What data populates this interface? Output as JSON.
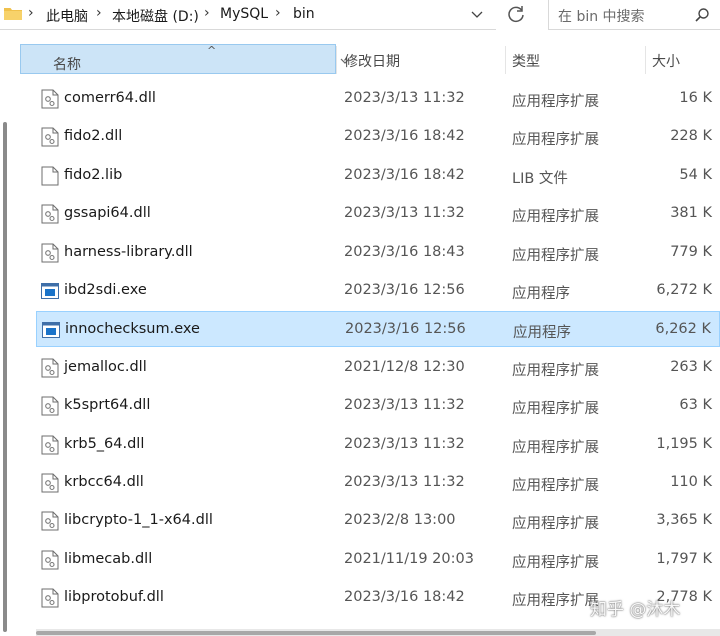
{
  "breadcrumb": {
    "items": [
      "此电脑",
      "本地磁盘 (D:)",
      "MySQL",
      "bin"
    ],
    "separator": "›"
  },
  "search": {
    "placeholder": "在 bin 中搜索"
  },
  "columns": {
    "name": "名称",
    "date": "修改日期",
    "type": "类型",
    "size": "大小"
  },
  "files": [
    {
      "name": "comerr64.dll",
      "date": "2023/3/13 11:32",
      "type": "应用程序扩展",
      "size": "16 K",
      "icon": "dll-file-icon"
    },
    {
      "name": "fido2.dll",
      "date": "2023/3/16 18:42",
      "type": "应用程序扩展",
      "size": "228 K",
      "icon": "dll-file-icon"
    },
    {
      "name": "fido2.lib",
      "date": "2023/3/16 18:42",
      "type": "LIB 文件",
      "size": "54 K",
      "icon": "blank-file-icon"
    },
    {
      "name": "gssapi64.dll",
      "date": "2023/3/13 11:32",
      "type": "应用程序扩展",
      "size": "381 K",
      "icon": "dll-file-icon"
    },
    {
      "name": "harness-library.dll",
      "date": "2023/3/16 18:43",
      "type": "应用程序扩展",
      "size": "779 K",
      "icon": "dll-file-icon"
    },
    {
      "name": "ibd2sdi.exe",
      "date": "2023/3/16 12:56",
      "type": "应用程序",
      "size": "6,272 K",
      "icon": "exe-file-icon"
    },
    {
      "name": "innochecksum.exe",
      "date": "2023/3/16 12:56",
      "type": "应用程序",
      "size": "6,262 K",
      "icon": "exe-file-icon",
      "selected": true
    },
    {
      "name": "jemalloc.dll",
      "date": "2021/12/8 12:30",
      "type": "应用程序扩展",
      "size": "263 K",
      "icon": "dll-file-icon"
    },
    {
      "name": "k5sprt64.dll",
      "date": "2023/3/13 11:32",
      "type": "应用程序扩展",
      "size": "63 K",
      "icon": "dll-file-icon"
    },
    {
      "name": "krb5_64.dll",
      "date": "2023/3/13 11:32",
      "type": "应用程序扩展",
      "size": "1,195 K",
      "icon": "dll-file-icon"
    },
    {
      "name": "krbcc64.dll",
      "date": "2023/3/13 11:32",
      "type": "应用程序扩展",
      "size": "110 K",
      "icon": "dll-file-icon"
    },
    {
      "name": "libcrypto-1_1-x64.dll",
      "date": "2023/2/8 13:00",
      "type": "应用程序扩展",
      "size": "3,365 K",
      "icon": "dll-file-icon"
    },
    {
      "name": "libmecab.dll",
      "date": "2021/11/19 20:03",
      "type": "应用程序扩展",
      "size": "1,797 K",
      "icon": "dll-file-icon"
    },
    {
      "name": "libprotobuf.dll",
      "date": "2023/3/16 18:42",
      "type": "应用程序扩展",
      "size": "2,778 K",
      "icon": "dll-file-icon"
    }
  ],
  "watermark": "知乎 @沐木",
  "colors": {
    "selection": "#cce8ff",
    "header_active": "#cce4f7",
    "exe_blue": "#1a73c9"
  }
}
